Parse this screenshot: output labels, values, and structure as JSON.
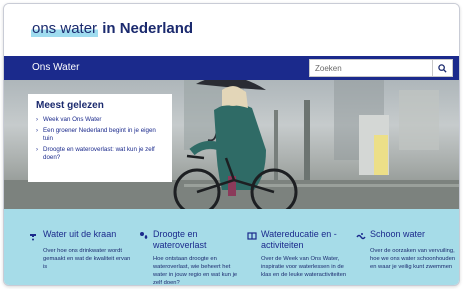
{
  "logo": {
    "part1": "ons",
    "part2": "water",
    "part3": "in Nederland"
  },
  "nav": {
    "title": "Ons Water"
  },
  "search": {
    "placeholder": "Zoeken",
    "icon": "search-icon"
  },
  "popular": {
    "heading": "Meest gelezen",
    "items": [
      "Week van Ons Water",
      "Een groener Nederland begint in je eigen tuin",
      "Droogte en wateroverlast: wat kun je zelf doen?"
    ]
  },
  "cards": [
    {
      "icon": "tap-icon",
      "title": "Water uit de kraan",
      "desc": "Over hoe ons drinkwater wordt gemaakt en wat de kwaliteit ervan is"
    },
    {
      "icon": "drought-icon",
      "title": "Droogte en wateroverlast",
      "desc": "Hoe ontstaan droogte en wateroverlast, wie beheert het water in jouw regio en wat kun je zelf doen?"
    },
    {
      "icon": "book-icon",
      "title": "Watereducatie en -activiteiten",
      "desc": "Over de Week van Ons Water, inspiratie voor waterlessen in de klas en de leuke wateractiviteiten"
    },
    {
      "icon": "wave-icon",
      "title": "Schoon water",
      "desc": "Over de oorzaken van vervuiling, hoe we ons water schoonhouden en waar je veilig kunt zwemmen"
    }
  ],
  "colors": {
    "navy": "#1b2a8c",
    "light_blue": "#a6dce8",
    "highlight": "#9fdcef"
  }
}
